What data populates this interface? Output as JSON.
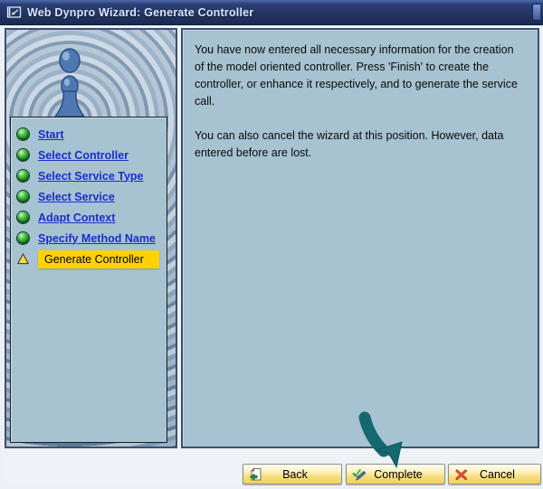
{
  "window": {
    "title": "Web Dynpro Wizard: Generate Controller"
  },
  "wizard": {
    "steps": [
      {
        "label": "Start",
        "state": "done"
      },
      {
        "label": "Select Controller",
        "state": "done"
      },
      {
        "label": "Select Service Type",
        "state": "done"
      },
      {
        "label": "Select Service",
        "state": "done"
      },
      {
        "label": "Adapt Context",
        "state": "done"
      },
      {
        "label": "Specify Method Name",
        "state": "done"
      },
      {
        "label": "Generate Controller",
        "state": "active"
      }
    ]
  },
  "content": {
    "paragraph1": "You have now entered all necessary information for the creation of the model oriented controller. Press 'Finish' to create the controller, or enhance it respectively, and to generate the service call.",
    "paragraph2": "You can also cancel the wizard at this position. However, data entered before are lost."
  },
  "footer": {
    "back_label": "Back",
    "complete_label": "Complete",
    "cancel_label": "Cancel"
  },
  "icons": {
    "titlebar": "window-exit-icon",
    "back": "page-with-green-back-arrow-icon",
    "complete": "green-check-with-pencil-icon",
    "cancel": "red-x-icon",
    "step_done": "green-orb-icon",
    "step_active": "yellow-triangle-icon",
    "annotation": "teal-arrow-pointing-to-complete"
  },
  "colors": {
    "titlebar_top": "#4a69ab",
    "titlebar_bottom": "#1b2a52",
    "panel_background": "#a7c2d1",
    "step_link_blue": "#1c2ecb",
    "active_step_highlight": "#ffd200",
    "button_face_gold": "#f3d25b",
    "annotation_arrow_teal": "#15686f",
    "cancel_red": "#c43b22",
    "check_green": "#2f9e38"
  }
}
